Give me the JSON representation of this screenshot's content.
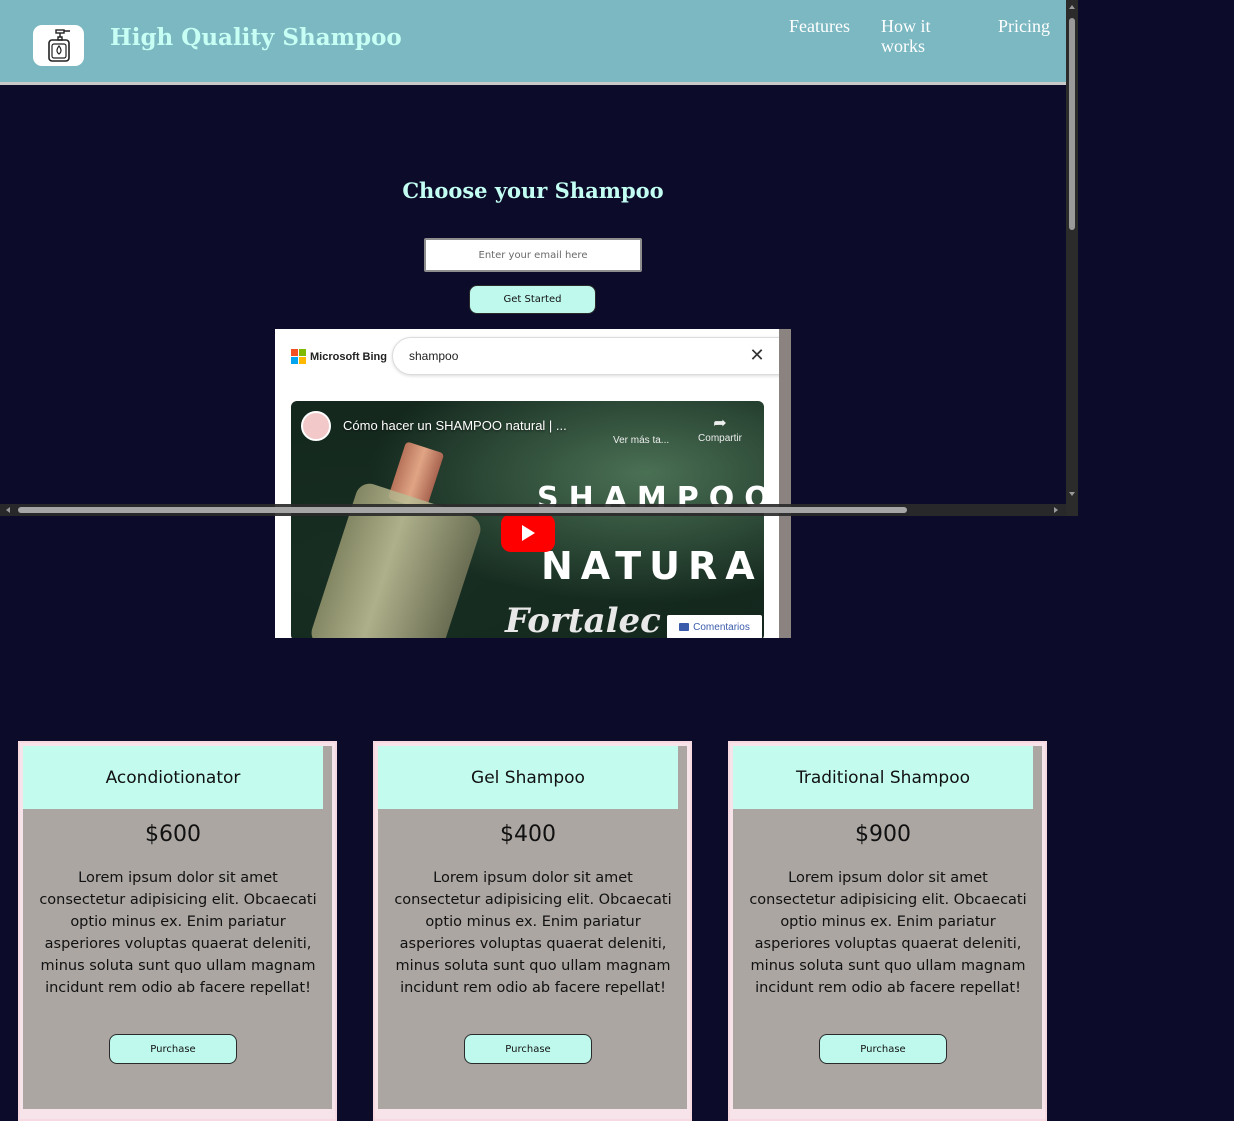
{
  "header": {
    "brand": "High Quality Shampoo",
    "logo_icon": "shampoo-bottle-icon",
    "nav": {
      "features": "Features",
      "how_it_works": "How it works",
      "pricing": "Pricing"
    }
  },
  "hero": {
    "title": "Choose your Shampoo",
    "email_placeholder": "Enter your email here",
    "cta_label": "Get Started"
  },
  "embed": {
    "bing_brand": "Microsoft Bing",
    "search_query": "shampoo",
    "video": {
      "title": "Cómo hacer un SHAMPOO natural | ...",
      "watch_later": "Ver más ta...",
      "share": "Compartir",
      "overlay_line1": "SHAMPOO",
      "overlay_line2": "NATURAL",
      "overlay_line3": "Fortalec",
      "comments": "Comentarios"
    }
  },
  "pricing": {
    "cards": [
      {
        "name": "Acondiotionator",
        "price": "$600",
        "description": "Lorem ipsum dolor sit amet consectetur adipisicing elit. Obcaecati optio minus ex. Enim pariatur asperiores voluptas quaerat deleniti, minus soluta sunt quo ullam magnam incidunt rem odio ab facere repellat!",
        "button": "Purchase"
      },
      {
        "name": "Gel Shampoo",
        "price": "$400",
        "description": "Lorem ipsum dolor sit amet consectetur adipisicing elit. Obcaecati optio minus ex. Enim pariatur asperiores voluptas quaerat deleniti, minus soluta sunt quo ullam magnam incidunt rem odio ab facere repellat!",
        "button": "Purchase"
      },
      {
        "name": "Traditional Shampoo",
        "price": "$900",
        "description": "Lorem ipsum dolor sit amet consectetur adipisicing elit. Obcaecati optio minus ex. Enim pariatur asperiores voluptas quaerat deleniti, minus soluta sunt quo ullam magnam incidunt rem odio ab facere repellat!",
        "button": "Purchase"
      }
    ]
  },
  "colors": {
    "page_bg": "#0c0c2a",
    "header_bg": "#7bb8c1",
    "accent_mint": "#c3fcef",
    "card_body": "#aba6a2",
    "youtube_red": "#ff0000"
  }
}
